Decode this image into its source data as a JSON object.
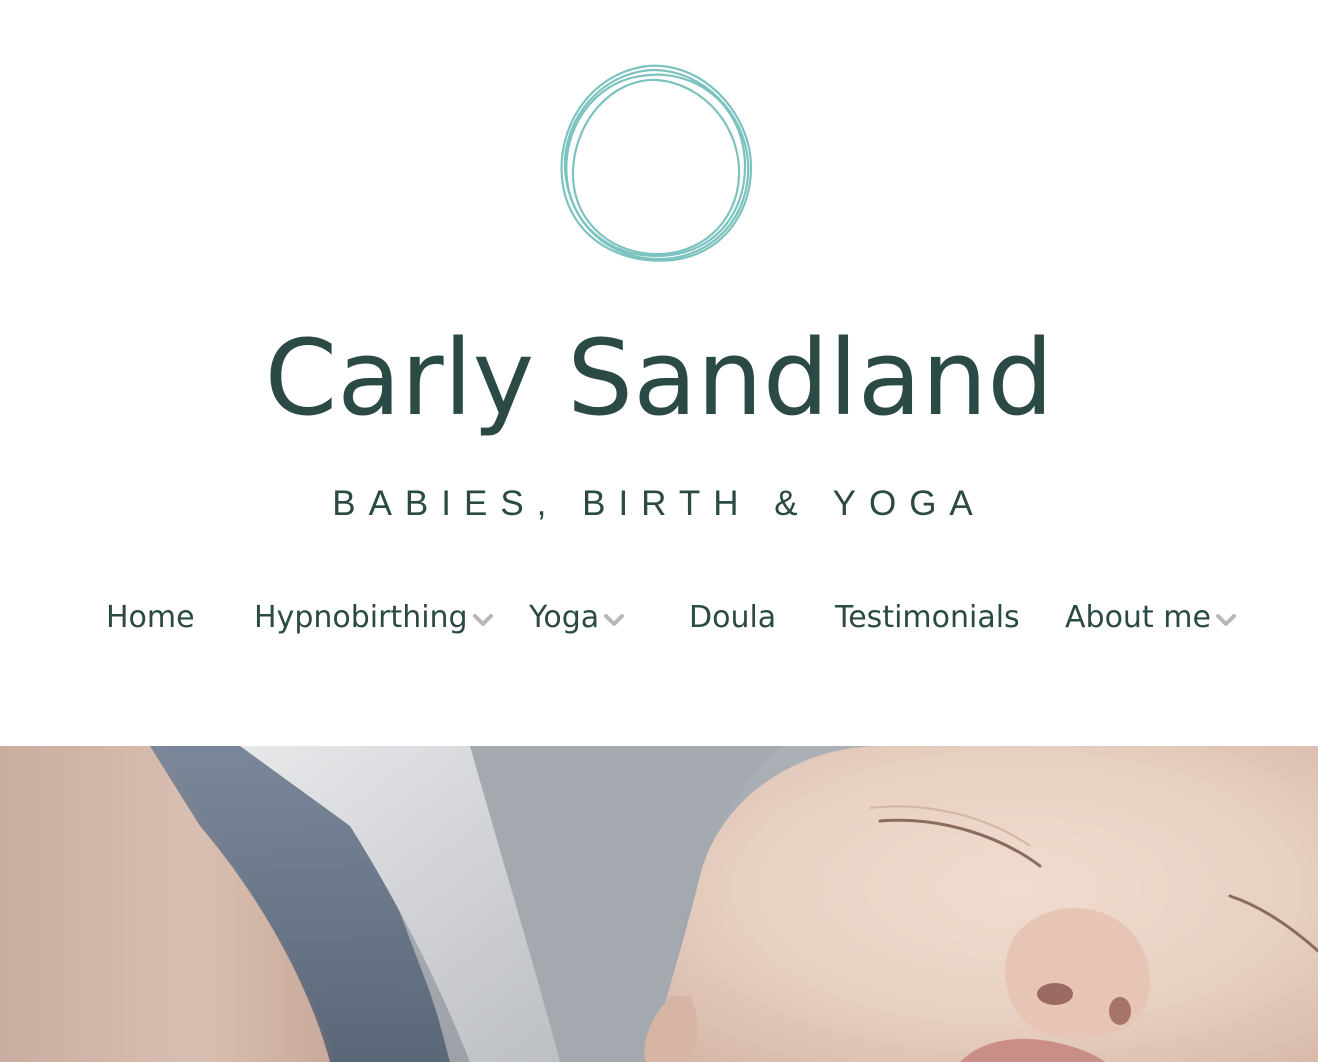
{
  "header": {
    "site_title": "Carly Sandland",
    "tagline": "BABIES, BIRTH & YOGA",
    "logo_icon": "circle-scribble-icon"
  },
  "nav": {
    "items": [
      {
        "label": "Home",
        "has_dropdown": false
      },
      {
        "label": "Hypnobirthing",
        "has_dropdown": true
      },
      {
        "label": "Yoga",
        "has_dropdown": true
      },
      {
        "label": "Doula",
        "has_dropdown": false
      },
      {
        "label": "Testimonials",
        "has_dropdown": false
      },
      {
        "label": "About me",
        "has_dropdown": true
      }
    ]
  },
  "colors": {
    "text": "#2b4a45",
    "logo_stroke": "#7cc3c0",
    "chevron": "#b8b8b8",
    "background": "#ffffff"
  },
  "hero": {
    "image": "sleeping-newborn-photo"
  }
}
